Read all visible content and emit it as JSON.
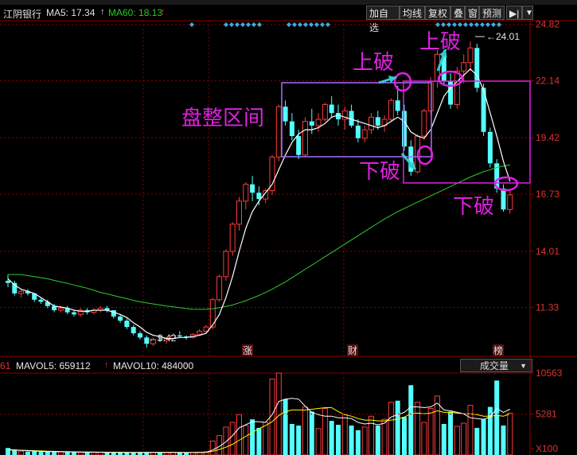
{
  "header": {
    "stock_name": "江阴银行",
    "ma5_label": "MA5: 17.34",
    "ma60_label": "MA60: 18.13",
    "buttons": [
      "加自选",
      "均线",
      "复权",
      "叠",
      "窗",
      "预测"
    ],
    "arrow_btn": "▶|"
  },
  "price_axis": {
    "ticks": [
      "24.82",
      "22.14",
      "19.42",
      "16.73",
      "14.01",
      "11.33"
    ]
  },
  "annotations": {
    "consolidation": "盘整区间",
    "up_break_1": "上破",
    "up_break_2": "上破",
    "down_break_1": "下破",
    "down_break_2": "下破",
    "high_marker": "24.01",
    "low_marker": "9.42",
    "event_1": "涨",
    "event_2": "财",
    "event_3": "榜"
  },
  "volume_header": {
    "prefix": "61",
    "mavol5": "MAVOL5: 659112",
    "mavol10": "MAVOL10: 484000",
    "selector": "成交量"
  },
  "volume_axis": {
    "ticks": [
      "10563",
      "5281",
      "X100"
    ]
  },
  "colors": {
    "up": "#ff3b3b",
    "down": "#54ffff",
    "ma5": "#ffffff",
    "ma60": "#2ecc2e",
    "annotation": "#e020e0",
    "arrow": "#33cccc",
    "grid": "#8b0000"
  },
  "chart_data": {
    "type": "candlestick",
    "ylim": [
      9.0,
      25.0
    ],
    "y_ticks": [
      24.82,
      22.14,
      19.42,
      16.73,
      14.01,
      11.33
    ],
    "high": 24.01,
    "low": 9.42,
    "ma5_last": 17.34,
    "ma60_last": 18.13,
    "candles": [
      [
        12.6,
        12.9,
        12.3,
        12.5
      ],
      [
        12.5,
        12.6,
        11.9,
        12.0
      ],
      [
        12.0,
        12.2,
        11.8,
        12.1
      ],
      [
        12.1,
        12.2,
        11.9,
        12.0
      ],
      [
        12.0,
        12.0,
        11.6,
        11.7
      ],
      [
        11.7,
        11.8,
        11.5,
        11.6
      ],
      [
        11.6,
        11.7,
        11.3,
        11.4
      ],
      [
        11.4,
        11.5,
        11.1,
        11.2
      ],
      [
        11.2,
        11.4,
        11.1,
        11.3
      ],
      [
        11.3,
        11.4,
        11.0,
        11.1
      ],
      [
        11.1,
        11.2,
        10.9,
        11.0
      ],
      [
        11.0,
        11.3,
        10.9,
        11.2
      ],
      [
        11.2,
        11.3,
        11.0,
        11.1
      ],
      [
        11.1,
        11.3,
        11.0,
        11.2
      ],
      [
        11.2,
        11.4,
        11.1,
        11.3
      ],
      [
        11.3,
        11.4,
        11.1,
        11.2
      ],
      [
        11.2,
        11.2,
        10.8,
        10.9
      ],
      [
        10.9,
        11.0,
        10.6,
        10.7
      ],
      [
        10.7,
        10.8,
        10.3,
        10.4
      ],
      [
        10.4,
        10.5,
        10.0,
        10.1
      ],
      [
        10.1,
        10.2,
        9.8,
        9.9
      ],
      [
        9.9,
        10.0,
        9.42,
        9.6
      ],
      [
        9.6,
        9.9,
        9.5,
        9.8
      ],
      [
        9.8,
        10.0,
        9.7,
        9.75
      ],
      [
        9.75,
        9.9,
        9.6,
        9.85
      ],
      [
        9.85,
        10.1,
        9.8,
        10.0
      ],
      [
        10.0,
        10.2,
        9.9,
        9.95
      ],
      [
        9.95,
        10.0,
        9.8,
        9.9
      ],
      [
        9.9,
        10.1,
        9.85,
        10.05
      ],
      [
        10.05,
        10.3,
        10.0,
        10.2
      ],
      [
        10.2,
        10.5,
        10.1,
        10.4
      ],
      [
        10.4,
        11.8,
        10.3,
        11.7
      ],
      [
        11.7,
        12.9,
        11.6,
        12.8
      ],
      [
        12.8,
        14.1,
        12.6,
        14.0
      ],
      [
        14.0,
        15.4,
        13.8,
        15.3
      ],
      [
        15.3,
        16.6,
        15.0,
        16.4
      ],
      [
        16.4,
        17.3,
        16.0,
        17.2
      ],
      [
        17.2,
        17.6,
        16.4,
        16.8
      ],
      [
        16.8,
        17.1,
        16.2,
        16.5
      ],
      [
        16.5,
        17.0,
        16.3,
        16.9
      ],
      [
        16.9,
        18.6,
        16.7,
        18.5
      ],
      [
        18.5,
        21.0,
        18.3,
        20.9
      ],
      [
        20.9,
        21.2,
        20.0,
        20.2
      ],
      [
        20.2,
        20.6,
        19.3,
        19.5
      ],
      [
        19.5,
        19.8,
        18.4,
        18.6
      ],
      [
        18.6,
        20.4,
        18.5,
        20.2
      ],
      [
        20.2,
        20.8,
        19.6,
        20.0
      ],
      [
        20.0,
        20.6,
        19.7,
        20.3
      ],
      [
        20.3,
        21.1,
        20.2,
        21.0
      ],
      [
        21.0,
        21.4,
        20.4,
        20.6
      ],
      [
        20.6,
        21.0,
        20.0,
        20.3
      ],
      [
        20.3,
        20.9,
        19.8,
        20.7
      ],
      [
        20.7,
        21.0,
        19.9,
        20.0
      ],
      [
        20.0,
        20.3,
        19.2,
        19.4
      ],
      [
        19.4,
        20.0,
        19.2,
        19.8
      ],
      [
        19.8,
        20.6,
        19.6,
        20.4
      ],
      [
        20.4,
        20.7,
        19.8,
        20.0
      ],
      [
        20.0,
        20.5,
        19.7,
        20.3
      ],
      [
        20.3,
        21.3,
        20.2,
        21.2
      ],
      [
        21.2,
        21.9,
        20.5,
        20.7
      ],
      [
        20.7,
        21.0,
        18.8,
        19.0
      ],
      [
        19.0,
        19.3,
        17.6,
        17.8
      ],
      [
        17.8,
        19.6,
        17.7,
        19.5
      ],
      [
        19.5,
        20.8,
        19.3,
        20.7
      ],
      [
        20.7,
        22.3,
        20.5,
        22.1
      ],
      [
        22.1,
        23.6,
        21.8,
        23.4
      ],
      [
        23.4,
        23.6,
        21.9,
        22.1
      ],
      [
        22.1,
        22.5,
        20.8,
        21.0
      ],
      [
        21.0,
        22.8,
        20.8,
        22.6
      ],
      [
        22.6,
        23.4,
        22.0,
        23.0
      ],
      [
        23.0,
        24.01,
        22.6,
        23.7
      ],
      [
        23.7,
        23.9,
        21.6,
        21.8
      ],
      [
        21.8,
        22.0,
        19.5,
        19.7
      ],
      [
        19.7,
        19.9,
        18.0,
        18.2
      ],
      [
        18.2,
        18.4,
        16.8,
        17.0
      ],
      [
        17.0,
        17.2,
        15.9,
        16.0
      ],
      [
        16.0,
        16.9,
        15.8,
        16.7
      ]
    ],
    "ma5": [
      12.7,
      12.4,
      12.2,
      12.1,
      12.0,
      11.8,
      11.6,
      11.4,
      11.35,
      11.3,
      11.2,
      11.15,
      11.15,
      11.2,
      11.2,
      11.2,
      11.1,
      11.0,
      10.85,
      10.6,
      10.4,
      10.15,
      10.0,
      9.95,
      9.85,
      9.85,
      9.9,
      9.9,
      9.95,
      10.0,
      10.1,
      10.5,
      11.0,
      11.8,
      12.8,
      14.0,
      15.1,
      15.9,
      16.4,
      16.8,
      17.2,
      17.9,
      18.6,
      19.2,
      19.6,
      19.8,
      19.8,
      19.9,
      20.1,
      20.4,
      20.5,
      20.4,
      20.3,
      20.2,
      20.1,
      20.0,
      19.9,
      20.0,
      20.2,
      20.4,
      20.2,
      19.7,
      19.5,
      19.4,
      19.8,
      20.6,
      21.4,
      21.8,
      22.1,
      22.4,
      22.7,
      22.4,
      21.7,
      20.6,
      19.5,
      18.3,
      17.34
    ],
    "ma60": [
      12.9,
      12.9,
      12.9,
      12.85,
      12.8,
      12.75,
      12.7,
      12.62,
      12.55,
      12.48,
      12.4,
      12.32,
      12.25,
      12.15,
      12.05,
      11.98,
      11.9,
      11.82,
      11.75,
      11.67,
      11.6,
      11.55,
      11.5,
      11.45,
      11.4,
      11.36,
      11.32,
      11.28,
      11.25,
      11.24,
      11.25,
      11.27,
      11.32,
      11.38,
      11.45,
      11.55,
      11.65,
      11.78,
      11.9,
      12.05,
      12.2,
      12.38,
      12.55,
      12.75,
      12.95,
      13.15,
      13.35,
      13.55,
      13.75,
      13.95,
      14.15,
      14.35,
      14.55,
      14.75,
      14.95,
      15.15,
      15.35,
      15.55,
      15.72,
      15.9,
      16.05,
      16.2,
      16.35,
      16.5,
      16.65,
      16.8,
      16.95,
      17.1,
      17.25,
      17.4,
      17.55,
      17.68,
      17.8,
      17.9,
      18.0,
      18.07,
      18.13
    ],
    "volume": {
      "ylim": [
        0,
        10563
      ],
      "y_ticks": [
        10563,
        5281
      ],
      "unit": "X100",
      "mavol5": 659112,
      "mavol10": 484000,
      "bars": [
        900,
        700,
        500,
        450,
        500,
        400,
        420,
        380,
        400,
        350,
        380,
        360,
        340,
        330,
        360,
        320,
        300,
        320,
        340,
        300,
        320,
        360,
        330,
        320,
        310,
        330,
        340,
        300,
        320,
        360,
        420,
        1800,
        2500,
        3600,
        4200,
        5200,
        3800,
        4600,
        3500,
        4200,
        9800,
        10563,
        7200,
        4000,
        3800,
        6200,
        5600,
        3400,
        6000,
        4400,
        3900,
        5200,
        3800,
        3200,
        3600,
        5000,
        3800,
        4600,
        6800,
        7000,
        4900,
        9000,
        6800,
        4200,
        6000,
        7600,
        4000,
        5600,
        3700,
        4100,
        6400,
        3500,
        4600,
        6200,
        9600,
        3800,
        5400
      ],
      "ma5": [
        700,
        660,
        600,
        560,
        510,
        460,
        440,
        420,
        410,
        400,
        380,
        370,
        365,
        355,
        350,
        340,
        330,
        325,
        325,
        320,
        325,
        330,
        330,
        330,
        325,
        325,
        320,
        318,
        320,
        330,
        350,
        650,
        1100,
        1700,
        2500,
        3500,
        3900,
        4300,
        4300,
        4200,
        5200,
        6900,
        7200,
        7300,
        7200,
        6300,
        5500,
        5200,
        5000,
        5000,
        4800,
        4800,
        4700,
        4200,
        4000,
        4100,
        3900,
        4100,
        4900,
        5200,
        5500,
        6200,
        6200,
        6100,
        6200,
        6700,
        5800,
        5700,
        5500,
        5300,
        4800,
        4700,
        4600,
        4900,
        6000,
        5500,
        5900
      ],
      "ma10": [
        650,
        630,
        610,
        580,
        550,
        520,
        490,
        470,
        450,
        430,
        410,
        400,
        390,
        380,
        370,
        360,
        350,
        345,
        340,
        335,
        330,
        330,
        330,
        328,
        325,
        325,
        324,
        322,
        322,
        325,
        335,
        480,
        720,
        1000,
        1380,
        1900,
        2400,
        2900,
        3400,
        3800,
        4300,
        5100,
        5600,
        5800,
        5800,
        5800,
        5900,
        6000,
        6100,
        6100,
        5600,
        5200,
        5000,
        4700,
        4500,
        4500,
        4400,
        4400,
        4500,
        4600,
        4900,
        5300,
        5400,
        5300,
        5400,
        5700,
        5500,
        5500,
        5400,
        5300,
        5300,
        5200,
        5000,
        5000,
        5100,
        5000,
        5300
      ]
    }
  }
}
